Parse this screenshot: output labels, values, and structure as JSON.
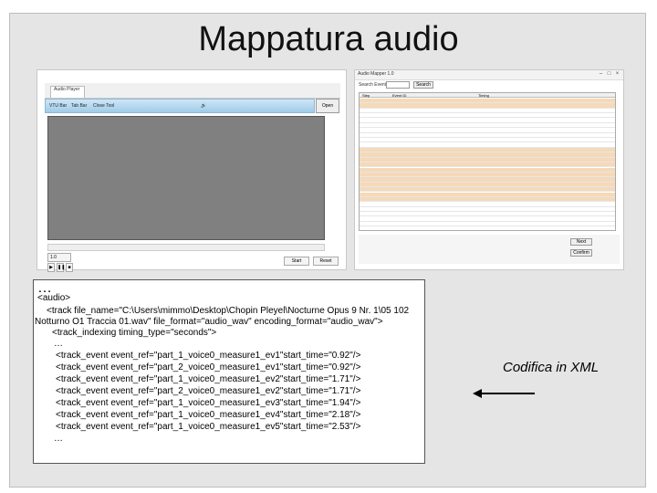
{
  "title": "Mappatura audio",
  "left_screenshot": {
    "tab_label": "Audio Player",
    "toolbar_items": [
      "VTU Bar",
      "Tab Bar",
      "Close Tool"
    ],
    "open_button": "Open",
    "speed_value": "1.0",
    "control_labels": [
      "Start",
      "Reset"
    ]
  },
  "right_screenshot": {
    "window_title": "Audio Mapper 1.0",
    "search_label": "Search Event",
    "search_button": "Search",
    "columns": [
      "Step",
      "Event ID",
      "Timing"
    ],
    "bottom_buttons": [
      "Next",
      "Confirm"
    ]
  },
  "code": {
    "ellipsis_top": "…",
    "lines": [
      "<audio>",
      "<track file_name=\"C:\\Users\\mimmo\\Desktop\\Chopin Pleyel\\Nocturne Opus 9 Nr. 1\\05 102",
      "Notturno O1 Traccia 01.wav\" file_format=\"audio_wav\" encoding_format=\"audio_wav\">",
      "<track_indexing timing_type=\"seconds\">",
      "…",
      "<track_event event_ref=\"part_1_voice0_measure1_ev1\"start_time=\"0.92\"/>",
      "<track_event event_ref=\"part_2_voice0_measure1_ev1\"start_time=\"0.92\"/>",
      "<track_event event_ref=\"part_1_voice0_measure1_ev2\"start_time=\"1.71\"/>",
      "<track_event event_ref=\"part_2_voice0_measure1_ev2\"start_time=\"1.71\"/>",
      "<track_event event_ref=\"part_1_voice0_measure1_ev3\"start_time=\"1.94\"/>",
      "<track_event event_ref=\"part_1_voice0_measure1_ev4\"start_time=\"2.18\"/>",
      "<track_event event_ref=\"part_1_voice0_measure1_ev5\"start_time=\"2.53\"/>",
      "…"
    ]
  },
  "side_label": "Codifica in XML"
}
